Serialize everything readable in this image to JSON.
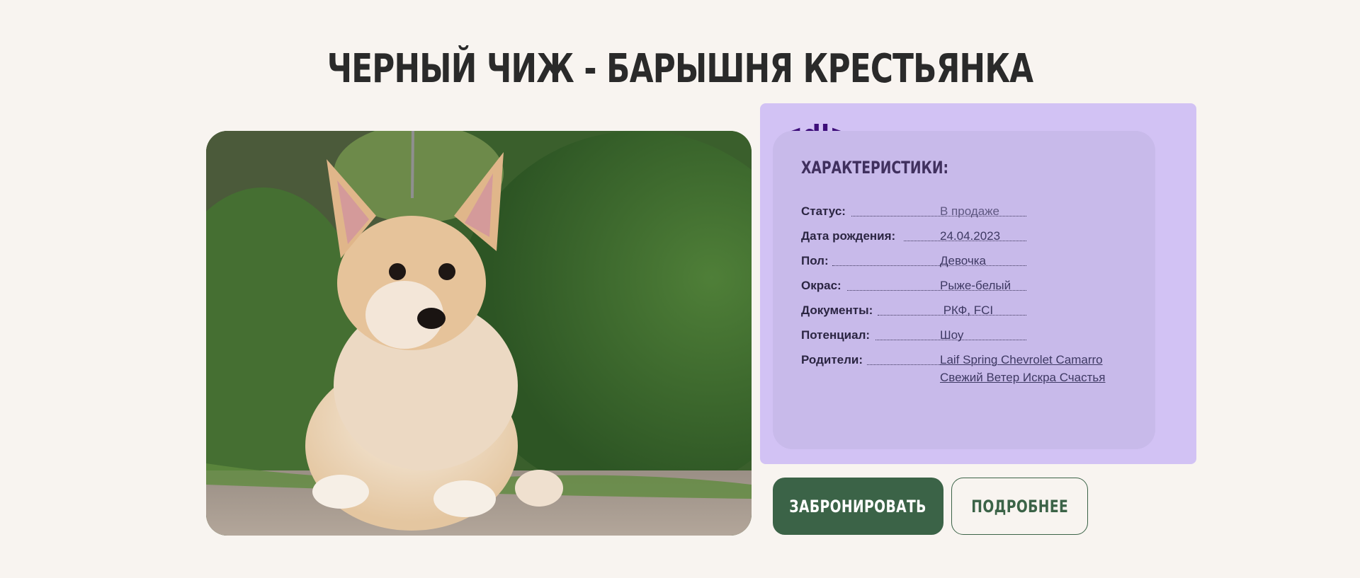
{
  "page": {
    "title": "ЧЕРНЫЙ ЧИЖ - БАРЫШНЯ КРЕСТЬЯНКА"
  },
  "photo": {
    "alt": "corgi puppy"
  },
  "card": {
    "tag": "<dl>",
    "heading": "ХАРАКТЕРИСТИКИ:",
    "rows": [
      {
        "label": "Статус:",
        "value": "В продаже"
      },
      {
        "label": "Дата рождения:",
        "value": "24.04.2023"
      },
      {
        "label": "Пол:",
        "value": "Девочка"
      },
      {
        "label": "Окрас:",
        "value": "Рыже-белый"
      },
      {
        "label": "Документы:",
        "value": " РКФ, FCI"
      },
      {
        "label": "Потенциал:",
        "value": "Шоу"
      },
      {
        "label": "Родители:",
        "value": "Laif Spring Chevrolet Camarro",
        "value2": "Свежий Ветер Искра Счастья"
      }
    ]
  },
  "buttons": {
    "book": "ЗАБРОНИРОВАТЬ",
    "more": "ПОДРОБНЕЕ"
  },
  "colors": {
    "background": "#f8f4f0",
    "card": "#d2c2f4",
    "accent": "#3b6347",
    "tag": "#3e0e7a"
  }
}
